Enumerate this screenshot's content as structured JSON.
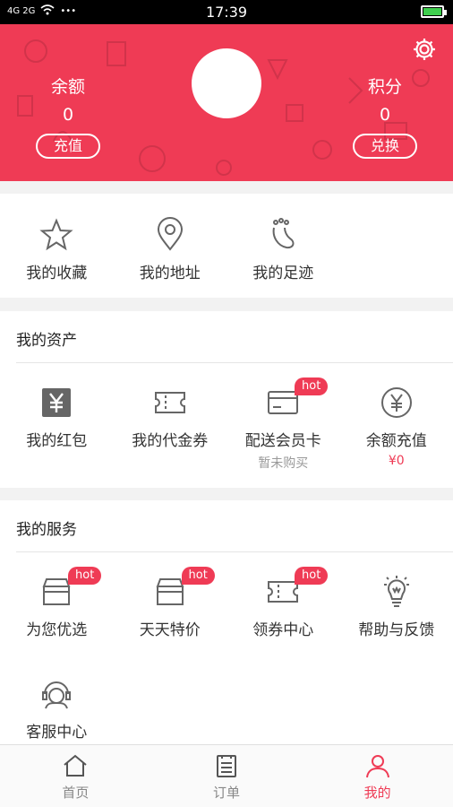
{
  "status_bar": {
    "time": "17:39",
    "network": "4G 2G"
  },
  "header": {
    "balance_label": "余额",
    "balance_value": "0",
    "recharge_button": "充值",
    "points_label": "积分",
    "points_value": "0",
    "exchange_button": "兑换",
    "accent_color": "#ef3b55"
  },
  "quick_links": [
    {
      "label": "我的收藏",
      "icon": "star-icon"
    },
    {
      "label": "我的地址",
      "icon": "location-pin-icon"
    },
    {
      "label": "我的足迹",
      "icon": "footprint-icon"
    }
  ],
  "assets": {
    "title": "我的资产",
    "items": [
      {
        "label": "我的红包",
        "icon": "red-packet-icon"
      },
      {
        "label": "我的代金券",
        "icon": "voucher-icon"
      },
      {
        "label": "配送会员卡",
        "icon": "member-card-icon",
        "badge": "hot",
        "sub": "暂未购买"
      },
      {
        "label": "余额充值",
        "icon": "yen-circle-icon",
        "sub": "¥0"
      }
    ]
  },
  "services": {
    "title": "我的服务",
    "items": [
      {
        "label": "为您优选",
        "icon": "store-icon",
        "badge": "hot"
      },
      {
        "label": "天天特价",
        "icon": "store-icon",
        "badge": "hot"
      },
      {
        "label": "领券中心",
        "icon": "ticket-icon",
        "badge": "hot"
      },
      {
        "label": "帮助与反馈",
        "icon": "lightbulb-icon"
      },
      {
        "label": "客服中心",
        "icon": "customer-service-icon"
      }
    ]
  },
  "tabbar": [
    {
      "label": "首页",
      "icon": "home-icon"
    },
    {
      "label": "订单",
      "icon": "order-list-icon"
    },
    {
      "label": "我的",
      "icon": "user-icon",
      "active": true
    }
  ]
}
